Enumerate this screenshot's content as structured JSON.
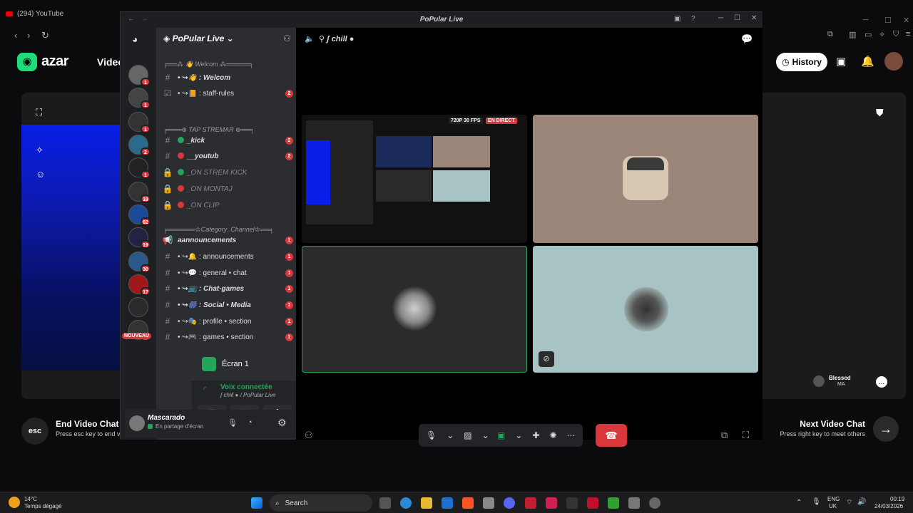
{
  "browser": {
    "tab_title": "(294) YouTube"
  },
  "azar": {
    "brand": "azar",
    "nav_video": "Video",
    "history_label": "History",
    "end_title": "End Video Chat",
    "end_sub": "Press esc key to end vi",
    "esc_label": "esc",
    "next_title": "Next Video Chat",
    "next_sub": "Press right key to meet others",
    "user_name": "Blessed",
    "user_country": "MA"
  },
  "discord": {
    "window_title": "PoPular Live",
    "server_name": "PoPular Live",
    "guild_badges": [
      "1",
      "1",
      "1",
      "2",
      "1",
      "18",
      "62",
      "19",
      "30",
      "17",
      "",
      "56"
    ],
    "new_badge": "NOUVEAU",
    "categories": [
      "Welcom",
      "TAP STREMAR",
      "Category_Channel"
    ],
    "channels": [
      {
        "icon": "#",
        "label": "• ↪👋 : Welcom",
        "badge": "",
        "style": "it"
      },
      {
        "icon": "☑",
        "label": "• ↪📙 : staff-rules",
        "badge": "2",
        "style": ""
      },
      {
        "icon": "#",
        "label": "_kick",
        "badge": "2",
        "style": "it",
        "dot": "#23a55a"
      },
      {
        "icon": "#",
        "label": "__youtub",
        "badge": "2",
        "style": "it",
        "dot": "#da373c"
      },
      {
        "icon": "🔒",
        "label": "_ON STREM KICK",
        "badge": "",
        "style": "muted",
        "dot": "#23a55a"
      },
      {
        "icon": "🔒",
        "label": "_ON MONTAJ",
        "badge": "",
        "style": "muted",
        "dot": "#da373c"
      },
      {
        "icon": "🔒",
        "label": "_ON CLIP",
        "badge": "",
        "style": "muted",
        "dot": "#da373c"
      },
      {
        "icon": "📢",
        "label": "aannouncements",
        "badge": "1",
        "style": "it"
      },
      {
        "icon": "#",
        "label": "• ↪🔔 : announcements",
        "badge": "1",
        "style": ""
      },
      {
        "icon": "#",
        "label": "• ↪💬 : general • chat",
        "badge": "1",
        "style": ""
      },
      {
        "icon": "#",
        "label": "• ↪📺 : Chat-games",
        "badge": "1",
        "style": "it"
      },
      {
        "icon": "#",
        "label": "• ↪🎆 : Social • Media",
        "badge": "1",
        "style": "it"
      },
      {
        "icon": "#",
        "label": "• ↪🎭 : profile • section",
        "badge": "1",
        "style": ""
      },
      {
        "icon": "#",
        "label": "• ↪🎮 : games • section",
        "badge": "1",
        "style": ""
      }
    ],
    "screen_share": "Écran 1",
    "voice_connected": "Voix connectée",
    "voice_channel": "ʃ chill ● / PoPular Live",
    "user_name": "Mascarado",
    "user_status": "En partage d'écran",
    "voice_channel_title": "ʃ chill",
    "stream_quality": "720P 30 FPS",
    "live_badge": "EN DIRECT"
  },
  "taskbar": {
    "weather_temp": "14°C",
    "weather_desc": "Temps dégagé",
    "search_placeholder": "Search",
    "lang": "ENG",
    "region": "UK",
    "time": "00:19",
    "date": "24/03/2026"
  },
  "colors": {
    "discord_red": "#da373c",
    "discord_green": "#23a55a",
    "azar_green": "#1fdc7a"
  }
}
